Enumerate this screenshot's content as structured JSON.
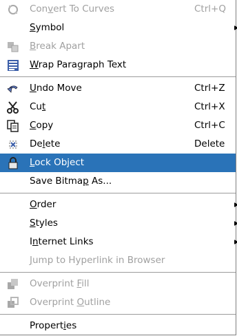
{
  "menu": {
    "group1": [
      {
        "pre": "Con",
        "mn": "v",
        "post": "ert To Curves",
        "shortcut": "Ctrl+Q",
        "icon": "convert-to-curves-icon"
      },
      {
        "pre": "",
        "mn": "S",
        "post": "ymbol",
        "arrow": "▸"
      },
      {
        "pre": "",
        "mn": "B",
        "post": "reak  Apart",
        "icon": "break-apart-icon"
      },
      {
        "pre": "",
        "mn": "W",
        "post": "rap Paragraph Text",
        "icon": "wrap-paragraph-icon"
      }
    ],
    "group2": [
      {
        "pre": "",
        "mn": "U",
        "post": "ndo Move",
        "shortcut": "Ctrl+Z",
        "icon": "undo-icon"
      },
      {
        "pre": "Cu",
        "mn": "t",
        "post": "",
        "shortcut": "Ctrl+X",
        "icon": "scissors-icon"
      },
      {
        "pre": "",
        "mn": "C",
        "post": "opy",
        "shortcut": "Ctrl+C",
        "icon": "copy-icon"
      },
      {
        "pre": "De",
        "mn": "l",
        "post": "ete",
        "shortcut": "Delete",
        "icon": "delete-icon"
      },
      {
        "pre": "",
        "mn": "L",
        "post": "ock Object",
        "icon": "lock-icon"
      },
      {
        "pre": "Save Bitma",
        "mn": "p",
        "post": " As..."
      }
    ],
    "group3": [
      {
        "pre": "",
        "mn": "O",
        "post": "rder",
        "arrow": "▸"
      },
      {
        "pre": "",
        "mn": "S",
        "post": "tyles",
        "arrow": "▸"
      },
      {
        "pre": "I",
        "mn": "n",
        "post": "ternet Links",
        "arrow": "▸"
      },
      {
        "pre": "",
        "mn": "J",
        "post": "ump to Hyperlink in Browser"
      }
    ],
    "group4": [
      {
        "pre": "Overprint ",
        "mn": "F",
        "post": "ill",
        "icon": "overprint-fill-icon"
      },
      {
        "pre": "Overprint ",
        "mn": "O",
        "post": "utline",
        "icon": "overprint-outline-icon"
      }
    ],
    "group5": [
      {
        "pre": "Propert",
        "mn": "i",
        "post": "es"
      }
    ]
  }
}
